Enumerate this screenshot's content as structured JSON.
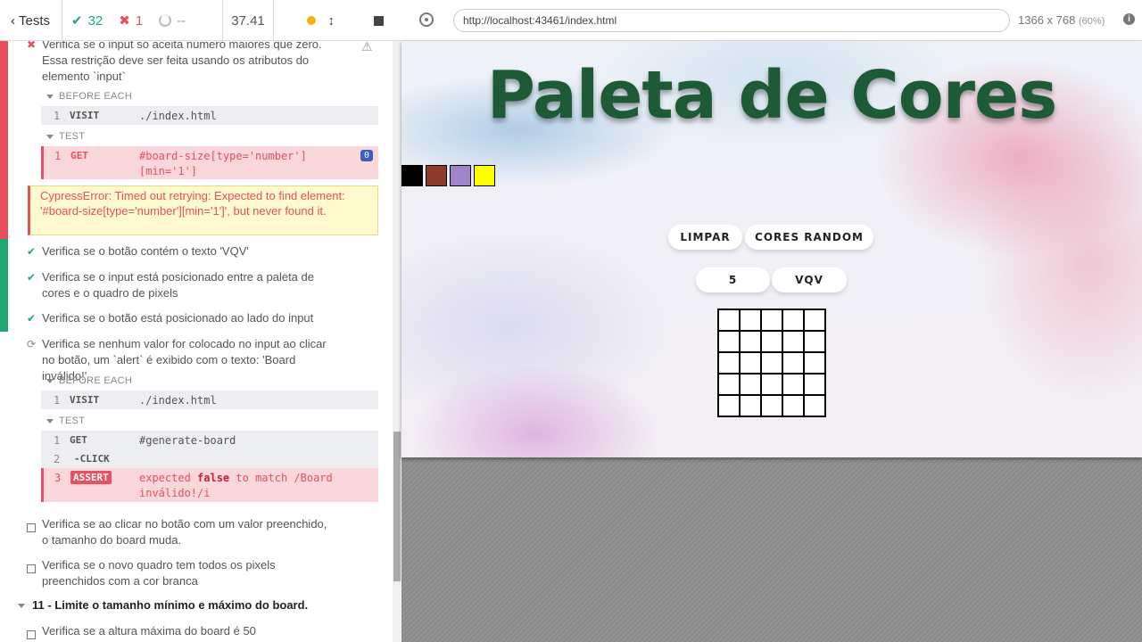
{
  "reporter": {
    "tests_label": "Tests",
    "passed": "32",
    "failed": "1",
    "pending": "--",
    "duration": "37.41",
    "tests": [
      {
        "status": "fail",
        "title": "Verifica se o input só aceita número maiores que zero. Essa restrição deve ser feita usando os atributos do elemento `input`"
      },
      {
        "status": "pass",
        "title": "Verifica se o botão contém o texto 'VQV'"
      },
      {
        "status": "pass",
        "title": "Verifica se o input está posicionado entre a paleta de cores e o quadro de pixels"
      },
      {
        "status": "pass",
        "title": "Verifica se o botão está posicionado ao lado do input"
      },
      {
        "status": "running",
        "title": "Verifica se nenhum valor for colocado no input ao clicar no botão, um `alert` é exibido com o texto: 'Board inválido!'"
      },
      {
        "status": "pending",
        "title": "Verifica se ao clicar no botão com um valor preenchido, o tamanho do board muda."
      },
      {
        "status": "pending",
        "title": "Verifica se o novo quadro tem todos os pixels preenchidos com a cor branca"
      },
      {
        "status": "pending",
        "title": "Verifica se a altura máxima do board é 50"
      }
    ],
    "before_each_label": "BEFORE EACH",
    "test_label": "TEST",
    "cmds_first": [
      {
        "num": "1",
        "name": "VISIT",
        "msg": "./index.html"
      },
      {
        "num": "1",
        "name": "GET",
        "msg": "#board-size[type='number'][min='1']",
        "badge": "0"
      }
    ],
    "error_text": "CypressError: Timed out retrying: Expected to find element: '#board-size[type='number'][min='1']', but never found it.",
    "cmds_second": [
      {
        "num": "1",
        "name": "VISIT",
        "msg": "./index.html"
      },
      {
        "num": "1",
        "name": "GET",
        "msg": "#generate-board"
      },
      {
        "num": "2",
        "name": "-CLICK",
        "msg": ""
      },
      {
        "num": "3",
        "name": "ASSERT",
        "msg_pre": "expected",
        "msg_bold": "false",
        "msg_post": "to match /Board inválido!/i"
      }
    ],
    "suite_title": "11 - Limite o tamanho mínimo e máximo do board."
  },
  "browser": {
    "url": "http://localhost:43461/index.html",
    "viewport": "1366 x 768",
    "zoom": "(60%)"
  },
  "app": {
    "title": "Paleta de Cores",
    "palette": [
      "#000000",
      "#8b3a2b",
      "#a083c9",
      "#ffff00"
    ],
    "clear_button": "LIMPAR",
    "random_button": "CORES RANDOM",
    "board_size_value": "5",
    "generate_button": "VQV",
    "board_size": 5
  }
}
